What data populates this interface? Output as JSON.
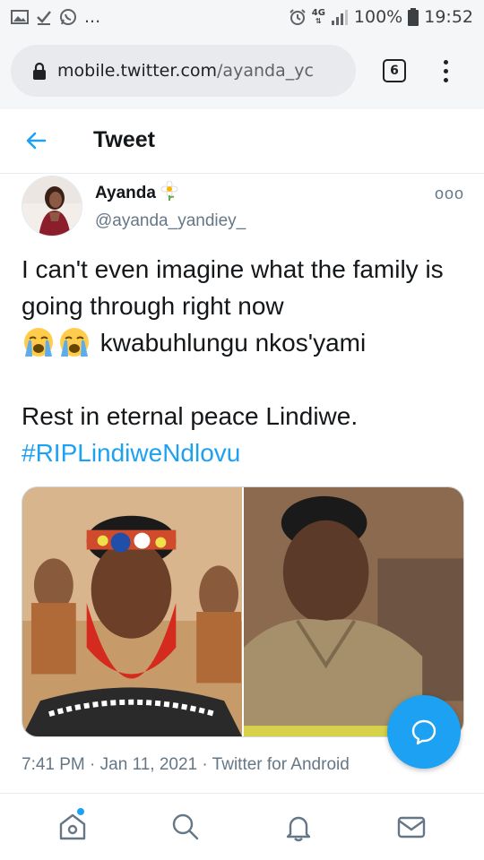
{
  "status_bar": {
    "network": "4G",
    "battery_text": "100%",
    "time": "19:52",
    "icons": [
      "gallery-icon",
      "download-done-icon",
      "whatsapp-icon",
      "more-notifications-icon",
      "alarm-icon",
      "network-4g-icon",
      "signal-icon",
      "battery-icon"
    ],
    "more": "..."
  },
  "browser": {
    "url_host": "mobile.twitter.com",
    "url_path": "/ayanda_yc",
    "tab_count": "6"
  },
  "header": {
    "title": "Tweet"
  },
  "tweet": {
    "author_name": "Ayanda",
    "author_handle": "@ayanda_yandiey_",
    "more": "ooo",
    "line1": "I can't even imagine what the family is going through right now",
    "line2": "kwabuhlungu nkos'yami",
    "line3": "Rest in eternal peace Lindiwe.",
    "hashtag": "#RIPLindiweNdlovu",
    "time": "7:41 PM",
    "date": "Jan 11, 2021",
    "separator": "·",
    "source": "Twitter for Android"
  },
  "colors": {
    "accent": "#1da1f2",
    "text": "#14171a",
    "muted": "#657786",
    "border": "#e6ecf0"
  },
  "bottom_nav": [
    "home-icon",
    "search-icon",
    "notifications-icon",
    "messages-icon"
  ]
}
